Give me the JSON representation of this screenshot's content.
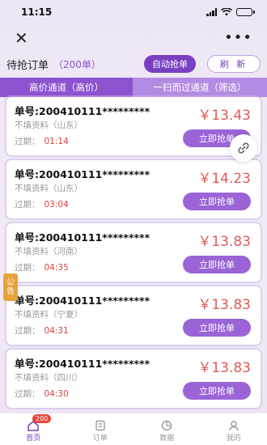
{
  "status_bar": {
    "time": "11:15"
  },
  "nav": {
    "close_icon": "close-icon",
    "more_icon": "more-icon"
  },
  "header": {
    "title": "待抢订单",
    "count": "（200单）",
    "auto_button": "自动抢单",
    "refresh_button": "刷 新"
  },
  "tabs": [
    {
      "label": "高价通道（高价）"
    },
    {
      "label": "一扫而过通道（筛选）"
    }
  ],
  "orders": [
    {
      "order_no": "单号:200410111*********",
      "region": "不填资料（山东）",
      "expire_label": "过期：",
      "expire": "01:14",
      "price": "￥13.43",
      "button": "立即抢单"
    },
    {
      "order_no": "单号:200410111*********",
      "region": "不填资料（山东）",
      "expire_label": "过期：",
      "expire": "03:04",
      "price": "￥14.23",
      "button": "立即抢单"
    },
    {
      "order_no": "单号:200410111*********",
      "region": "不填资料（河南）",
      "expire_label": "过期：",
      "expire": "04:35",
      "price": "￥13.83",
      "button": "立即抢单"
    },
    {
      "order_no": "单号:200410111*********",
      "region": "不填资料（宁夏）",
      "expire_label": "过期：",
      "expire": "04:31",
      "price": "￥13.83",
      "button": "立即抢单"
    },
    {
      "order_no": "单号:200410111*********",
      "region": "不填资料（四川）",
      "expire_label": "过期：",
      "expire": "04:30",
      "price": "￥13.83",
      "button": "立即抢单"
    }
  ],
  "notice": {
    "label_top": "公",
    "label_bottom": "告"
  },
  "bottom_nav": {
    "items": [
      {
        "label": "首页",
        "icon": "home-icon",
        "badge": "200"
      },
      {
        "label": "订单",
        "icon": "order-icon"
      },
      {
        "label": "数据",
        "icon": "data-icon"
      },
      {
        "label": "我的",
        "icon": "profile-icon"
      }
    ]
  },
  "colors": {
    "accent": "#7a3fc0",
    "tab_bar": "#8c52cf",
    "price": "#e05a56",
    "expire": "#d9433f"
  }
}
